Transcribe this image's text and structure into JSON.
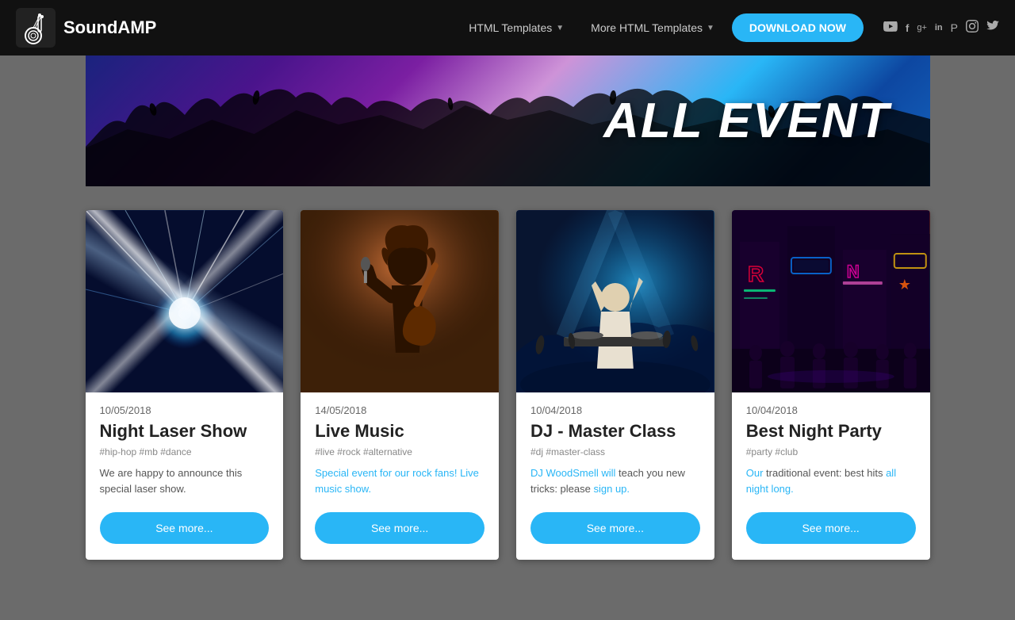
{
  "brand": {
    "name": "SoundAMP",
    "icon_label": "guitar-icon"
  },
  "navbar": {
    "links": [
      {
        "label": "HTML Templates",
        "has_dropdown": true
      },
      {
        "label": "More HTML Templates",
        "has_dropdown": true
      }
    ],
    "cta_button": "DOWNLOAD NOW",
    "social": [
      {
        "name": "youtube-icon",
        "symbol": "▶"
      },
      {
        "name": "facebook-icon",
        "symbol": "f"
      },
      {
        "name": "google-plus-icon",
        "symbol": "g+"
      },
      {
        "name": "linkedin-icon",
        "symbol": "in"
      },
      {
        "name": "pinterest-icon",
        "symbol": "P"
      },
      {
        "name": "instagram-icon",
        "symbol": "◻"
      },
      {
        "name": "twitter-icon",
        "symbol": "t"
      }
    ]
  },
  "hero": {
    "title": "ALL EVENT"
  },
  "events": {
    "cards": [
      {
        "date": "10/05/2018",
        "title": "Night Laser Show",
        "tags": "#hip-hop #mb #dance",
        "description": "We are happy to announce this special laser show.",
        "button_label": "See more...",
        "image_type": "laser"
      },
      {
        "date": "14/05/2018",
        "title": "Live Music",
        "tags": "#live #rock #alternative",
        "description": "Special event for our rock fans! Live music show.",
        "button_label": "See more...",
        "image_type": "music"
      },
      {
        "date": "10/04/2018",
        "title": "DJ - Master Class",
        "tags": "#dj #master-class",
        "description": "DJ WoodSmell will teach you new tricks: please sign up.",
        "description_links": [
          "DJ WoodSmell will",
          "sign up"
        ],
        "button_label": "See more...",
        "image_type": "dj"
      },
      {
        "date": "10/04/2018",
        "title": "Best Night Party",
        "tags": "#party #club",
        "description": "Our traditional event: best hits all night long.",
        "description_links": [
          "Our",
          "all night long."
        ],
        "button_label": "See more...",
        "image_type": "party"
      }
    ]
  }
}
